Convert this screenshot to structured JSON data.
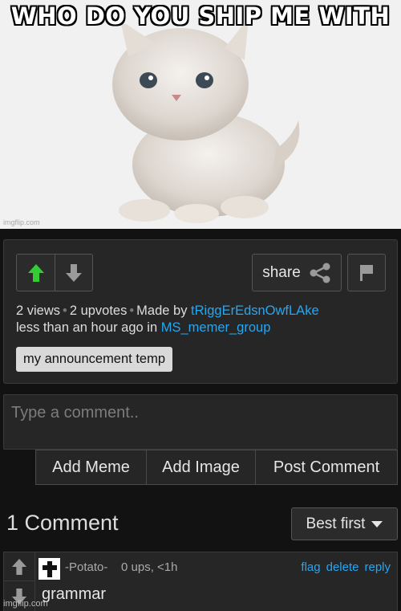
{
  "meme": {
    "caption": "WHO DO YOU SHIP ME WITH",
    "watermark": "imgflip.com",
    "image_subject": "fluffy white kitten"
  },
  "post": {
    "share_label": "share",
    "views": "2 views",
    "upvotes": "2 upvotes",
    "made_by_prefix": "Made by",
    "author": "tRiggErEdsnOwfLAke",
    "time_text": "less than an hour ago in",
    "stream": "MS_memer_group",
    "tag": "my announcement temp"
  },
  "comment_form": {
    "placeholder": "Type a comment..",
    "add_meme": "Add Meme",
    "add_image": "Add Image",
    "post_comment": "Post Comment"
  },
  "comments_header": {
    "count_label": "1 Comment",
    "sort_label": "Best first"
  },
  "comments": [
    {
      "user": "-Potato-",
      "stats": "0 ups, <1h",
      "actions": [
        "flag",
        "delete",
        "reply"
      ],
      "text": "grammar"
    }
  ],
  "page_watermark": "imgflip.com",
  "colors": {
    "background": "#121212",
    "panel": "#262626",
    "link": "#27a6f2",
    "upvote_active": "#33cc33"
  }
}
